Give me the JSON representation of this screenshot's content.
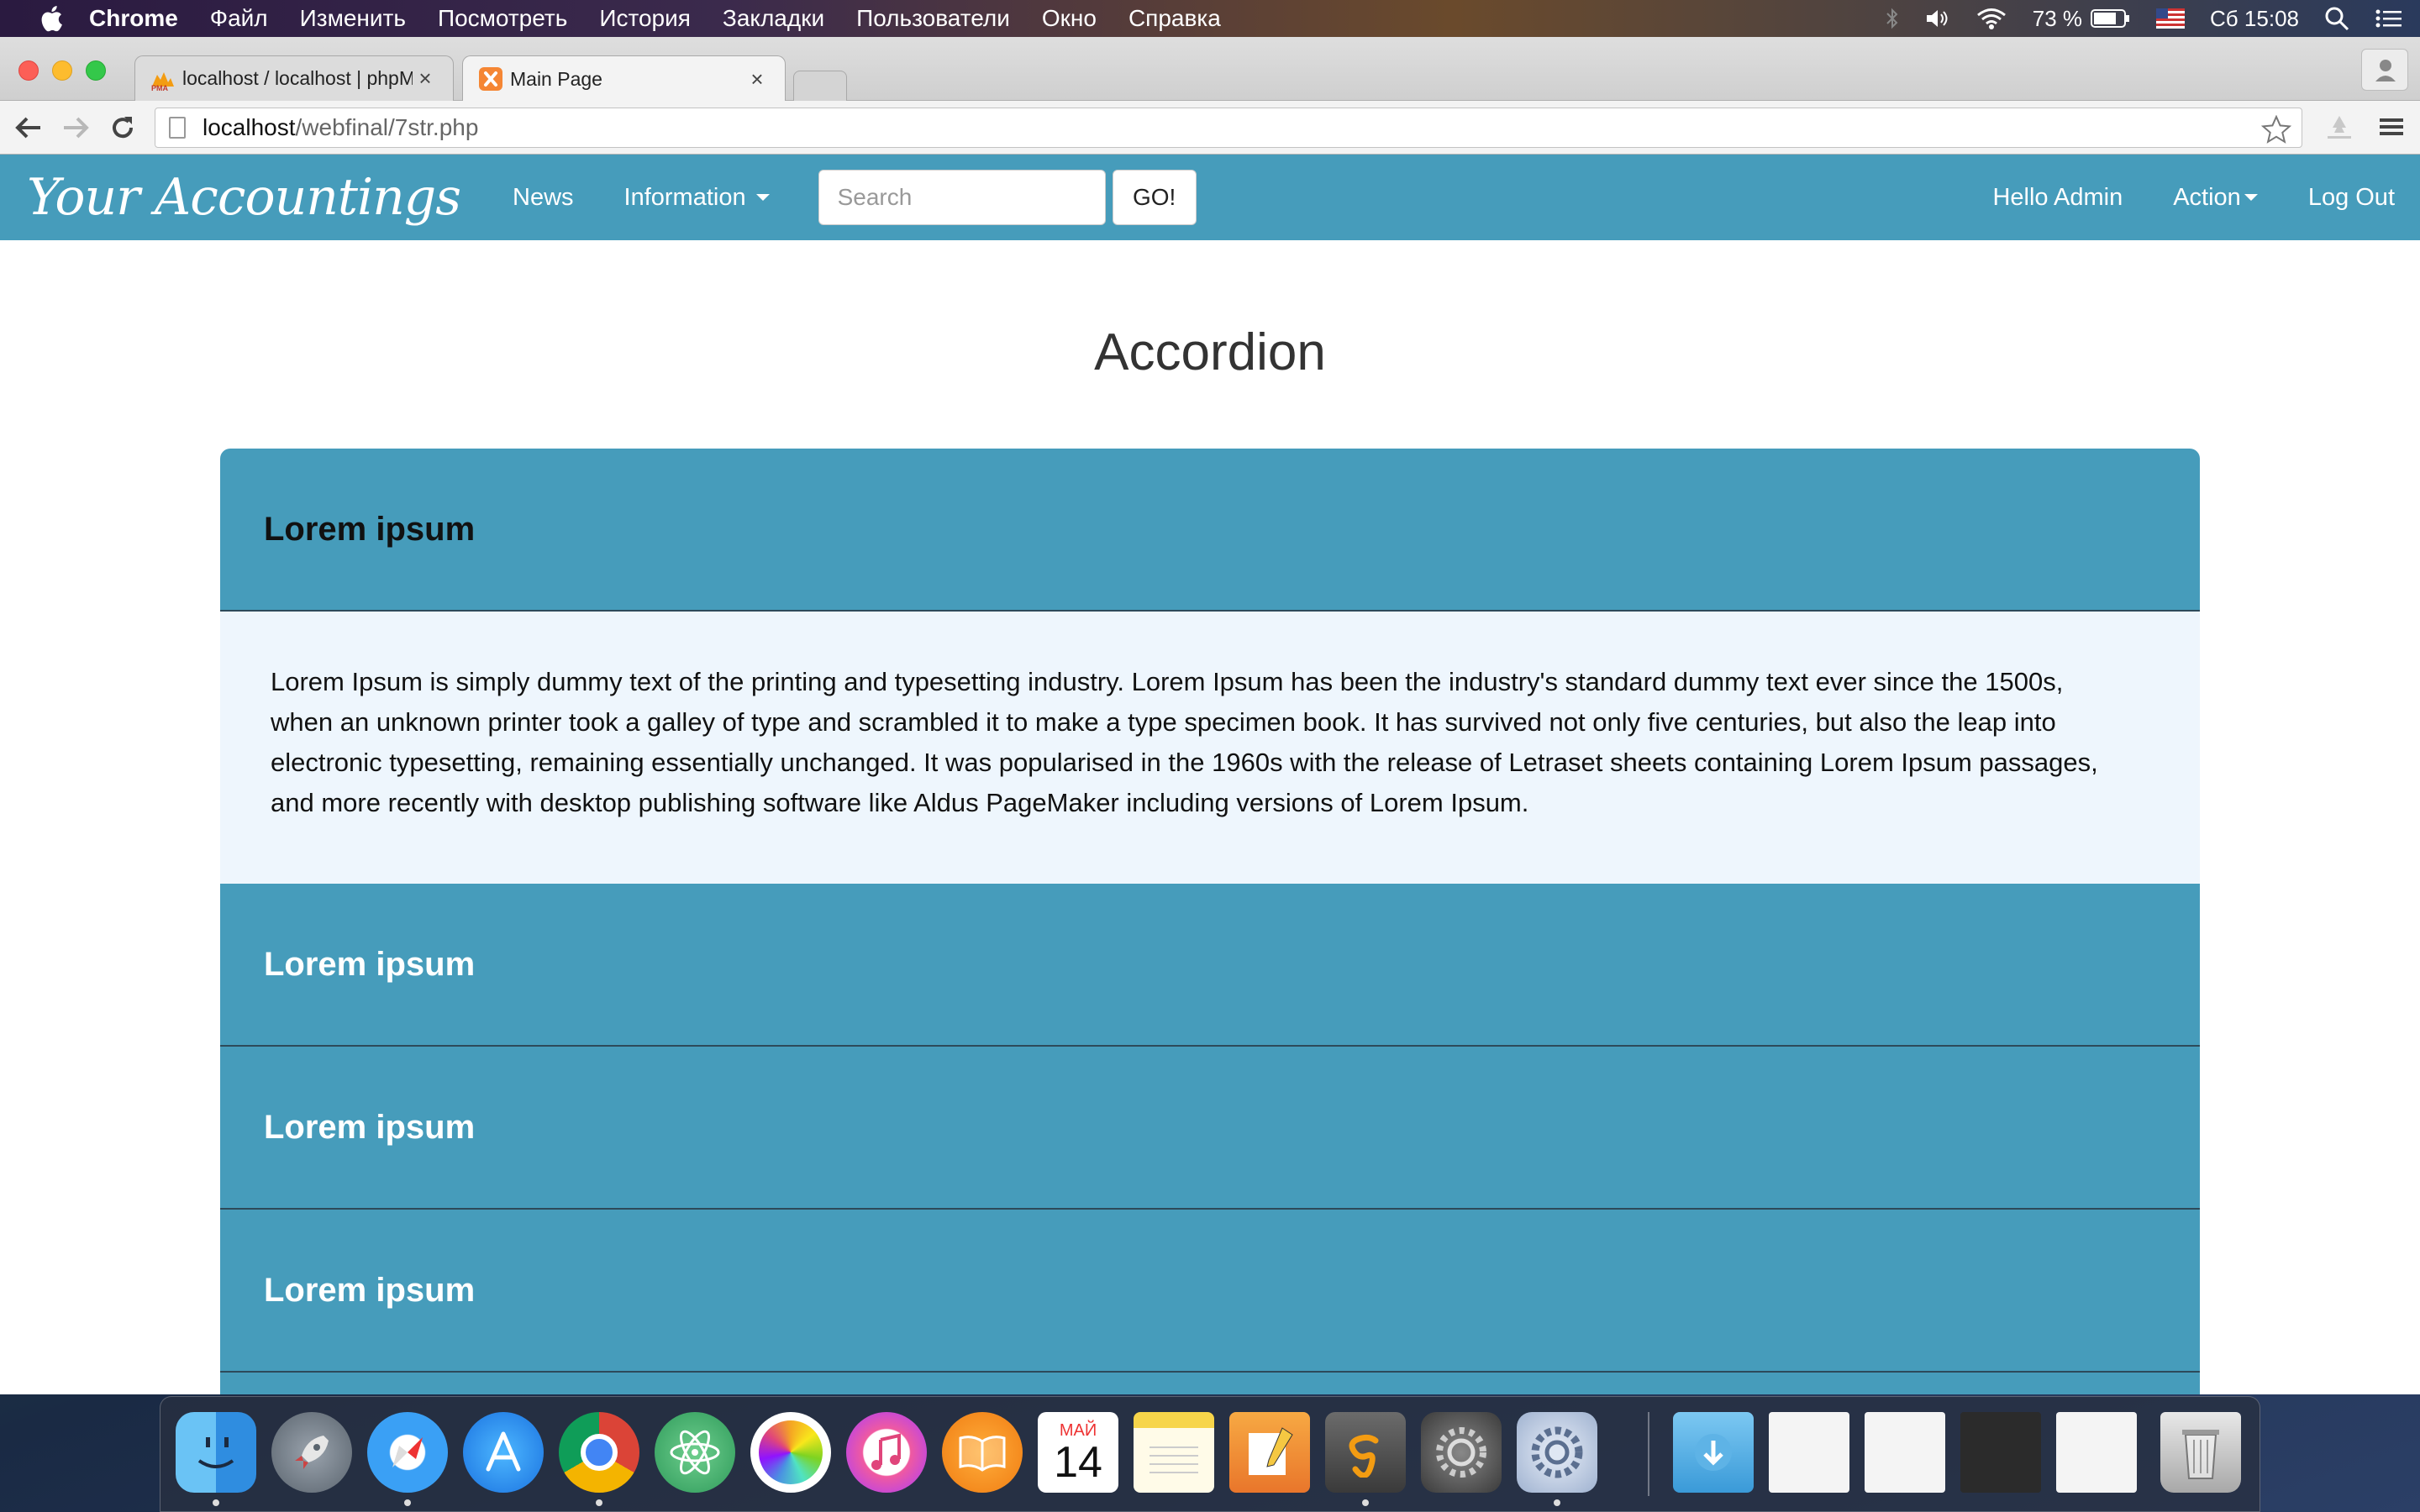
{
  "menubar": {
    "app_name": "Chrome",
    "items": [
      "Файл",
      "Изменить",
      "Посмотреть",
      "История",
      "Закладки",
      "Пользователи",
      "Окно",
      "Справка"
    ],
    "battery": "73 %",
    "clock": "Сб 15:08"
  },
  "browser": {
    "tabs": [
      {
        "title": "localhost / localhost | phpMyAdmin",
        "favicon": "phpmyadmin-icon"
      },
      {
        "title": "Main Page",
        "favicon": "xampp-icon"
      }
    ],
    "url_host": "localhost",
    "url_path": "/webfinal/7str.php"
  },
  "site": {
    "brand": "Your Accountings",
    "nav": {
      "news": "News",
      "information": "Information",
      "search_placeholder": "Search",
      "go": "GO!",
      "hello": "Hello Admin",
      "action": "Action",
      "logout": "Log Out"
    },
    "colors": {
      "navbar": "#469cbb",
      "accordion_header": "#469cbb",
      "accordion_body": "#eef6fd"
    }
  },
  "page": {
    "title": "Accordion",
    "accordion": [
      {
        "header": "Lorem ipsum",
        "open": true,
        "body": "Lorem Ipsum is simply dummy text of the printing and typesetting industry. Lorem Ipsum has been the industry's standard dummy text ever since the 1500s, when an unknown printer took a galley of type and scrambled it to make a type specimen book. It has survived not only five centuries, but also the leap into electronic typesetting, remaining essentially unchanged. It was popularised in the 1960s with the release of Letraset sheets containing Lorem Ipsum passages, and more recently with desktop publishing software like Aldus PageMaker including versions of Lorem Ipsum."
      },
      {
        "header": "Lorem ipsum",
        "open": false
      },
      {
        "header": "Lorem ipsum",
        "open": false
      },
      {
        "header": "Lorem ipsum",
        "open": false
      },
      {
        "header": "",
        "open": false
      }
    ]
  },
  "dock": {
    "calendar_month": "МАЙ",
    "calendar_day": "14",
    "apps": [
      "finder-icon",
      "launchpad-icon",
      "safari-icon",
      "app-store-icon",
      "chrome-icon",
      "atom-icon",
      "photos-icon",
      "itunes-icon",
      "ibooks-icon",
      "calendar-icon",
      "notes-icon",
      "pages-icon",
      "sublime-text-icon",
      "system-preferences-icon",
      "preferences-icon"
    ]
  }
}
